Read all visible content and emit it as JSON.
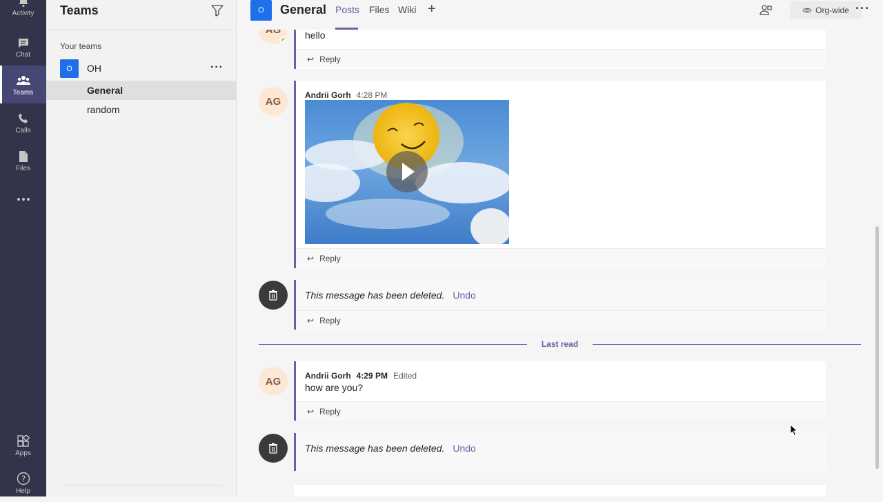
{
  "rail": {
    "items": [
      {
        "label": "Activity",
        "icon": "bell-icon"
      },
      {
        "label": "Chat",
        "icon": "chat-icon"
      },
      {
        "label": "Teams",
        "icon": "teams-icon"
      },
      {
        "label": "Calls",
        "icon": "phone-icon"
      },
      {
        "label": "Files",
        "icon": "file-icon"
      },
      {
        "label": "Apps",
        "icon": "apps-icon"
      },
      {
        "label": "Help",
        "icon": "help-icon"
      }
    ]
  },
  "panel": {
    "title": "Teams",
    "section": "Your teams",
    "team": {
      "avatar": "O",
      "name": "OH"
    },
    "channels": [
      {
        "name": "General",
        "active": true
      },
      {
        "name": "random",
        "active": false
      }
    ]
  },
  "header": {
    "avatar": "O",
    "title": "General",
    "tabs": [
      "Posts",
      "Files",
      "Wiki"
    ],
    "org_wide": "Org-wide"
  },
  "messages": {
    "m1": {
      "text": "hello",
      "reply": "Reply"
    },
    "m2": {
      "avatar": "AG",
      "author": "Andrii Gorh",
      "time": "4:28 PM",
      "reply": "Reply"
    },
    "m3": {
      "text": "This message has been deleted.",
      "undo": "Undo",
      "reply": "Reply"
    },
    "m4": {
      "avatar": "AG",
      "author": "Andrii Gorh",
      "time": "4:29 PM",
      "edited": "Edited",
      "text": "how are you?",
      "reply": "Reply"
    },
    "m5": {
      "text": "This message has been deleted.",
      "undo": "Undo"
    }
  },
  "last_read": "Last read",
  "colors": {
    "rail": "#33344a",
    "accent": "#6264a7",
    "team_avatar": "#1f6feb"
  }
}
